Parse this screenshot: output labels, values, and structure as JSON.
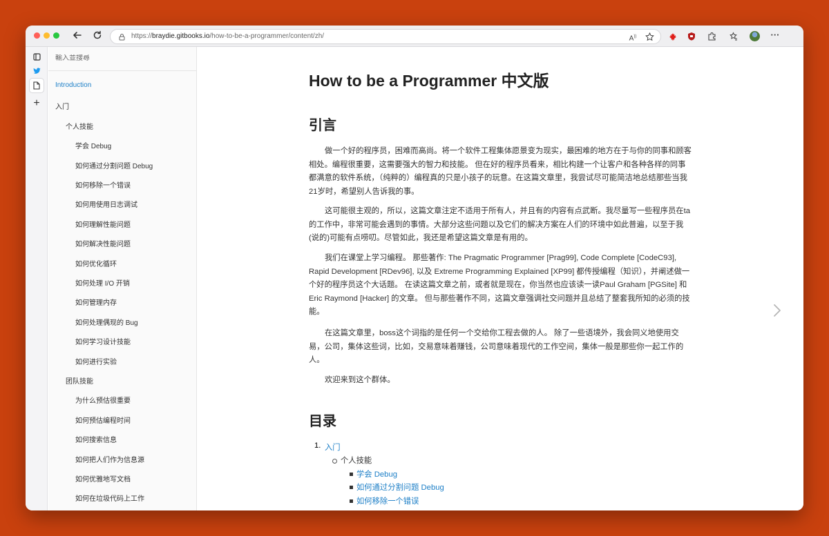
{
  "browser": {
    "url_prefix": "https://",
    "url_domain": "braydie.gitbooks.io",
    "url_path": "/how-to-be-a-programmer/content/zh/",
    "back_icon": "arrow-left-icon",
    "reload_icon": "reload-icon",
    "toolbar_icons": [
      "read-aloud-icon",
      "favorite-star-icon",
      "maple-leaf-icon",
      "shield-icon",
      "extensions-icon",
      "collections-icon",
      "profile-avatar",
      "more-icon"
    ]
  },
  "sidebar": {
    "search_placeholder": "輸入並搜尋",
    "items": [
      {
        "label": "Introduction",
        "level": 0,
        "active": true
      },
      {
        "label": "入门",
        "level": 0
      },
      {
        "label": "个人技能",
        "level": 1
      },
      {
        "label": "学会 Debug",
        "level": 2
      },
      {
        "label": "如何通过分割问题 Debug",
        "level": 2
      },
      {
        "label": "如何移除一个错误",
        "level": 2
      },
      {
        "label": "如何用使用日志调试",
        "level": 2
      },
      {
        "label": "如何理解性能问题",
        "level": 2
      },
      {
        "label": "如何解决性能问题",
        "level": 2
      },
      {
        "label": "如何优化循环",
        "level": 2
      },
      {
        "label": "如何处理 I/O 开销",
        "level": 2
      },
      {
        "label": "如何管理内存",
        "level": 2
      },
      {
        "label": "如何处理偶现的 Bug",
        "level": 2
      },
      {
        "label": "如何学习设计技能",
        "level": 2
      },
      {
        "label": "如何进行实验",
        "level": 2
      },
      {
        "label": "团队技能",
        "level": 1
      },
      {
        "label": "为什么预估很重要",
        "level": 2
      },
      {
        "label": "如何预估编程时间",
        "level": 2
      },
      {
        "label": "如何搜索信息",
        "level": 2
      },
      {
        "label": "如何把人们作为信息源",
        "level": 2
      },
      {
        "label": "如何优雅地写文档",
        "level": 2
      },
      {
        "label": "如何在垃圾代码上工作",
        "level": 2
      }
    ]
  },
  "content": {
    "title": "How to be a Programmer 中文版",
    "intro_heading": "引言",
    "paragraphs": [
      "做一个好的程序员，困难而高尚。将一个软件工程集体愿景变为现实，最困难的地方在于与你的同事和顾客相处。编程很重要，这需要强大的智力和技能。 但在好的程序员看来，相比构建一个让客户和各种各样的同事都满意的软件系统，（纯粹的）编程真的只是小孩子的玩意。在这篇文章里，我尝试尽可能简洁地总结那些当我21岁时，希望别人告诉我的事。",
      "这可能很主观的，所以，这篇文章注定不适用于所有人，并且有的内容有点武断。我尽量写一些程序员在ta的工作中，非常可能会遇到的事情。大部分这些问题以及它们的解决方案在人们的环境中如此普遍，以至于我(说的)可能有点唠叨。尽管如此，我还是希望这篇文章是有用的。",
      "我们在课堂上学习编程。 那些著作: The Pragmatic Programmer [Prag99], Code Complete [CodeC93], Rapid Development [RDev96], 以及 Extreme Programming Explained [XP99] 都传授编程（知识），并阐述做一个好的程序员这个大话题。 在读这篇文章之前，或者就是现在，你当然也应该读一读Paul Graham [PGSite] 和 Eric Raymond [Hacker] 的文章。 但与那些著作不同，这篇文章强调社交问题并且总结了整套我所知的必须的技能。",
      "在这篇文章里，boss这个词指的是任何一个交给你工程去做的人。 除了一些语境外，我会同义地使用交易，公司，集体这些词，比如，交易意味着赚钱，公司意味着现代的工作空间，集体一般是那些你一起工作的人。",
      "欢迎来到这个群体。"
    ],
    "toc_heading": "目录",
    "toc": {
      "item1_num": "1.",
      "item1": "入门",
      "sub1": "个人技能",
      "subsub": [
        "学会 Debug",
        "如何通过分割问题 Debug",
        "如何移除一个错误"
      ]
    }
  },
  "colors": {
    "desktop_bg": "#C9410E",
    "link": "#1D7FC7",
    "text": "#333333",
    "heading": "#222222"
  }
}
